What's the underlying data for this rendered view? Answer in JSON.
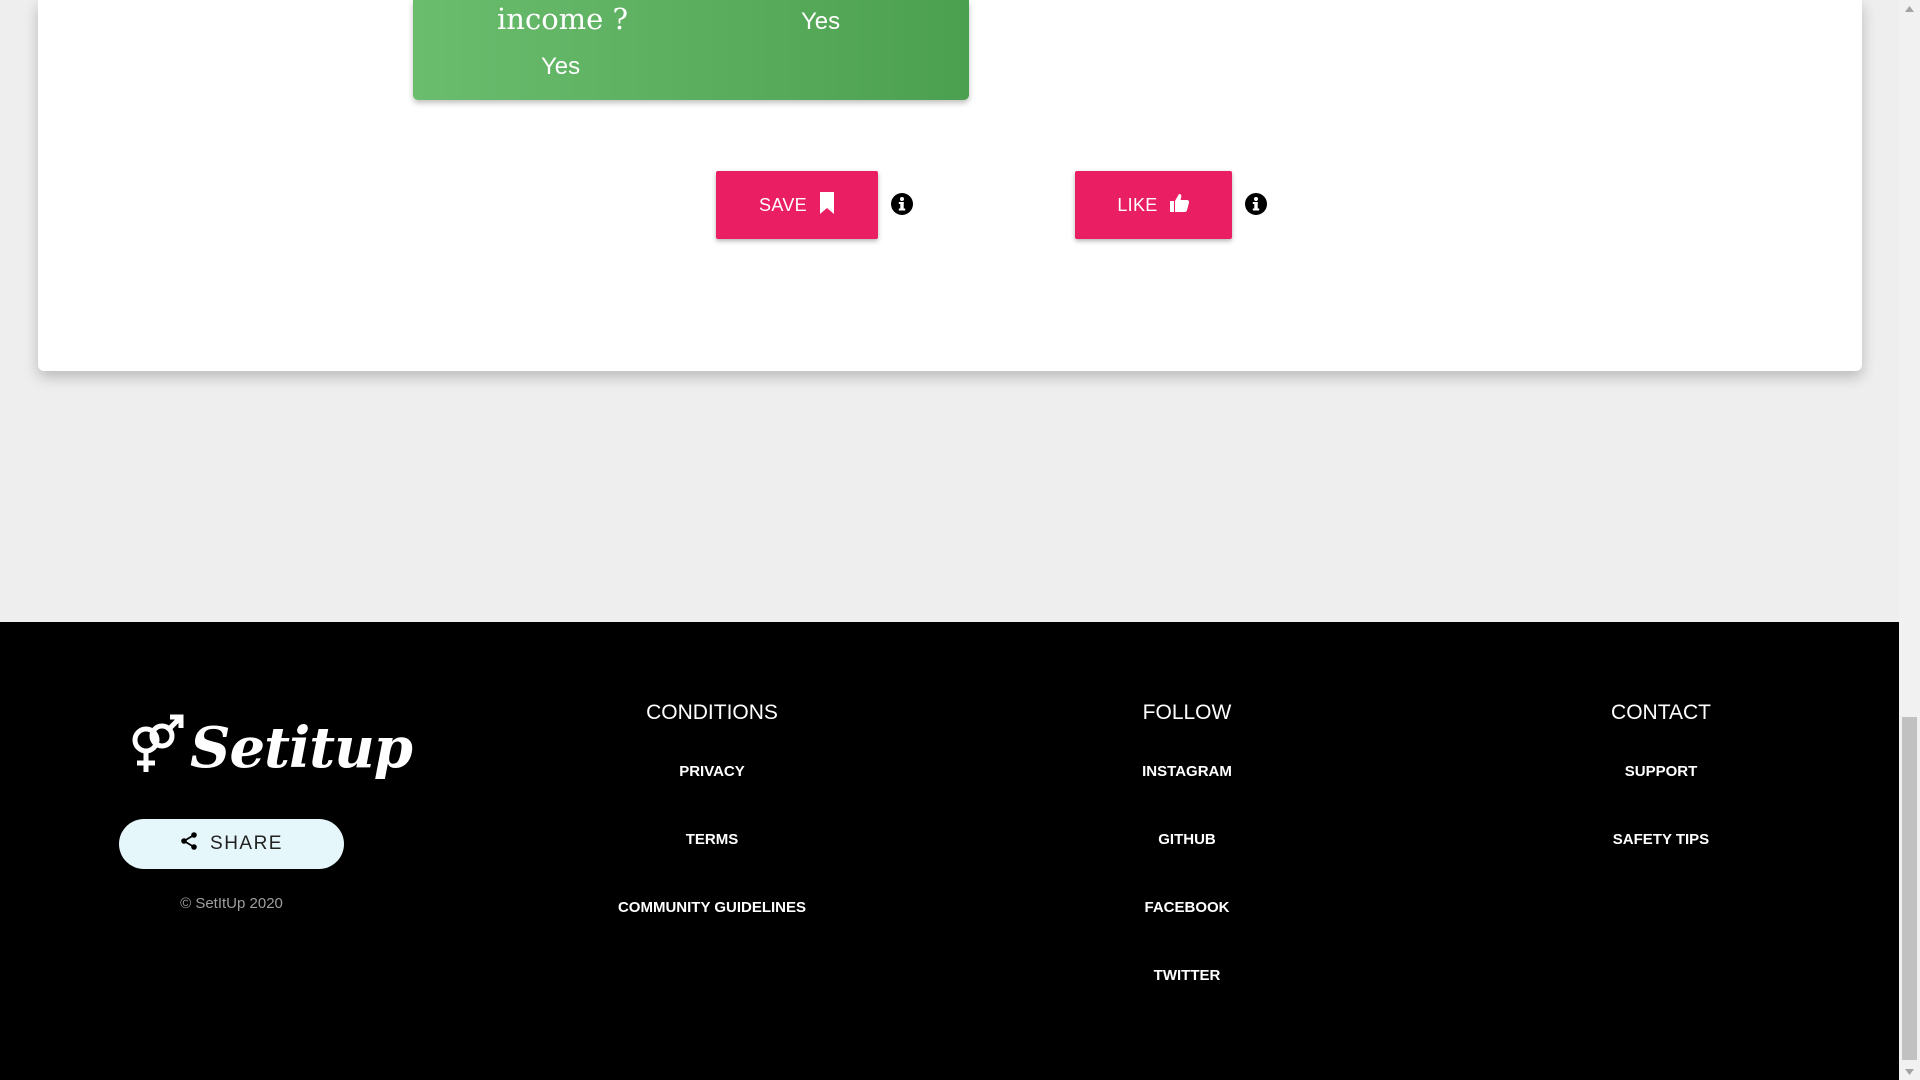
{
  "card": {
    "question": "income ?",
    "answer_left": "Yes",
    "answer_right": "Yes",
    "green_color": "#4caf50"
  },
  "actions": {
    "save_label": "SAVE",
    "like_label": "LIKE",
    "button_color": "#e91e63",
    "save_icon": "bookmark-icon",
    "like_icon": "thumbs-up-icon",
    "info_icon": "info-icon"
  },
  "footer": {
    "logo_text": "Setitup",
    "logo_icon": "gender-symbol-icon",
    "share_label": "SHARE",
    "share_icon": "share-icon",
    "copyright": "© SetItUp 2020",
    "columns": [
      {
        "heading": "CONDITIONS",
        "links": [
          "PRIVACY",
          "TERMS",
          "COMMUNITY GUIDELINES"
        ]
      },
      {
        "heading": "FOLLOW",
        "links": [
          "INSTAGRAM",
          "GITHUB",
          "FACEBOOK",
          "TWITTER"
        ]
      },
      {
        "heading": "CONTACT",
        "links": [
          "SUPPORT",
          "SAFETY TIPS"
        ]
      }
    ]
  }
}
